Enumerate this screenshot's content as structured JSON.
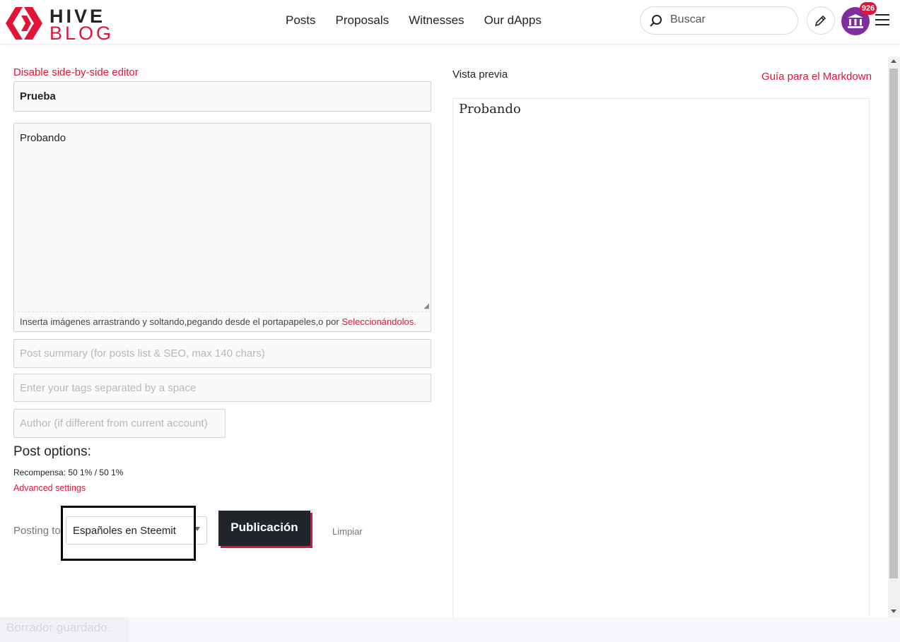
{
  "header": {
    "logo_top": "HIVE",
    "logo_bottom": "BLOG",
    "nav": [
      "Posts",
      "Proposals",
      "Witnesses",
      "Our dApps"
    ],
    "search_placeholder": "Buscar",
    "notification_count": "926",
    "avatar_icon": "temple-icon"
  },
  "editor": {
    "disable_side_by_side": "Disable side-by-side editor",
    "title_value": "Prueba",
    "body_value": "Probando",
    "dropzone_text": "Inserta imágenes arrastrando y soltando,pegando desde el portapapeles,o por ",
    "dropzone_link": "Seleccionándolos.",
    "summary_placeholder": "Post summary (for posts list & SEO, max 140 chars)",
    "tags_placeholder": "Enter your tags separated by a space",
    "author_placeholder": "Author (if different from current account)",
    "post_options_heading": "Post options:",
    "reward_text": "Recompensa: 50 1% / 50 1%",
    "advanced_settings": "Advanced settings",
    "posting_to_label": "Posting to",
    "community_selected": "Españoles en Steemit",
    "publish_button": "Publicación",
    "clear_button": "Limpiar"
  },
  "preview": {
    "label": "Vista previa",
    "markdown_guide": "Guía para el Markdown",
    "content": "Probando"
  },
  "status": {
    "saved_text": "Borrador guardado."
  },
  "colors": {
    "accent": "#e31337",
    "dark": "#212529"
  }
}
